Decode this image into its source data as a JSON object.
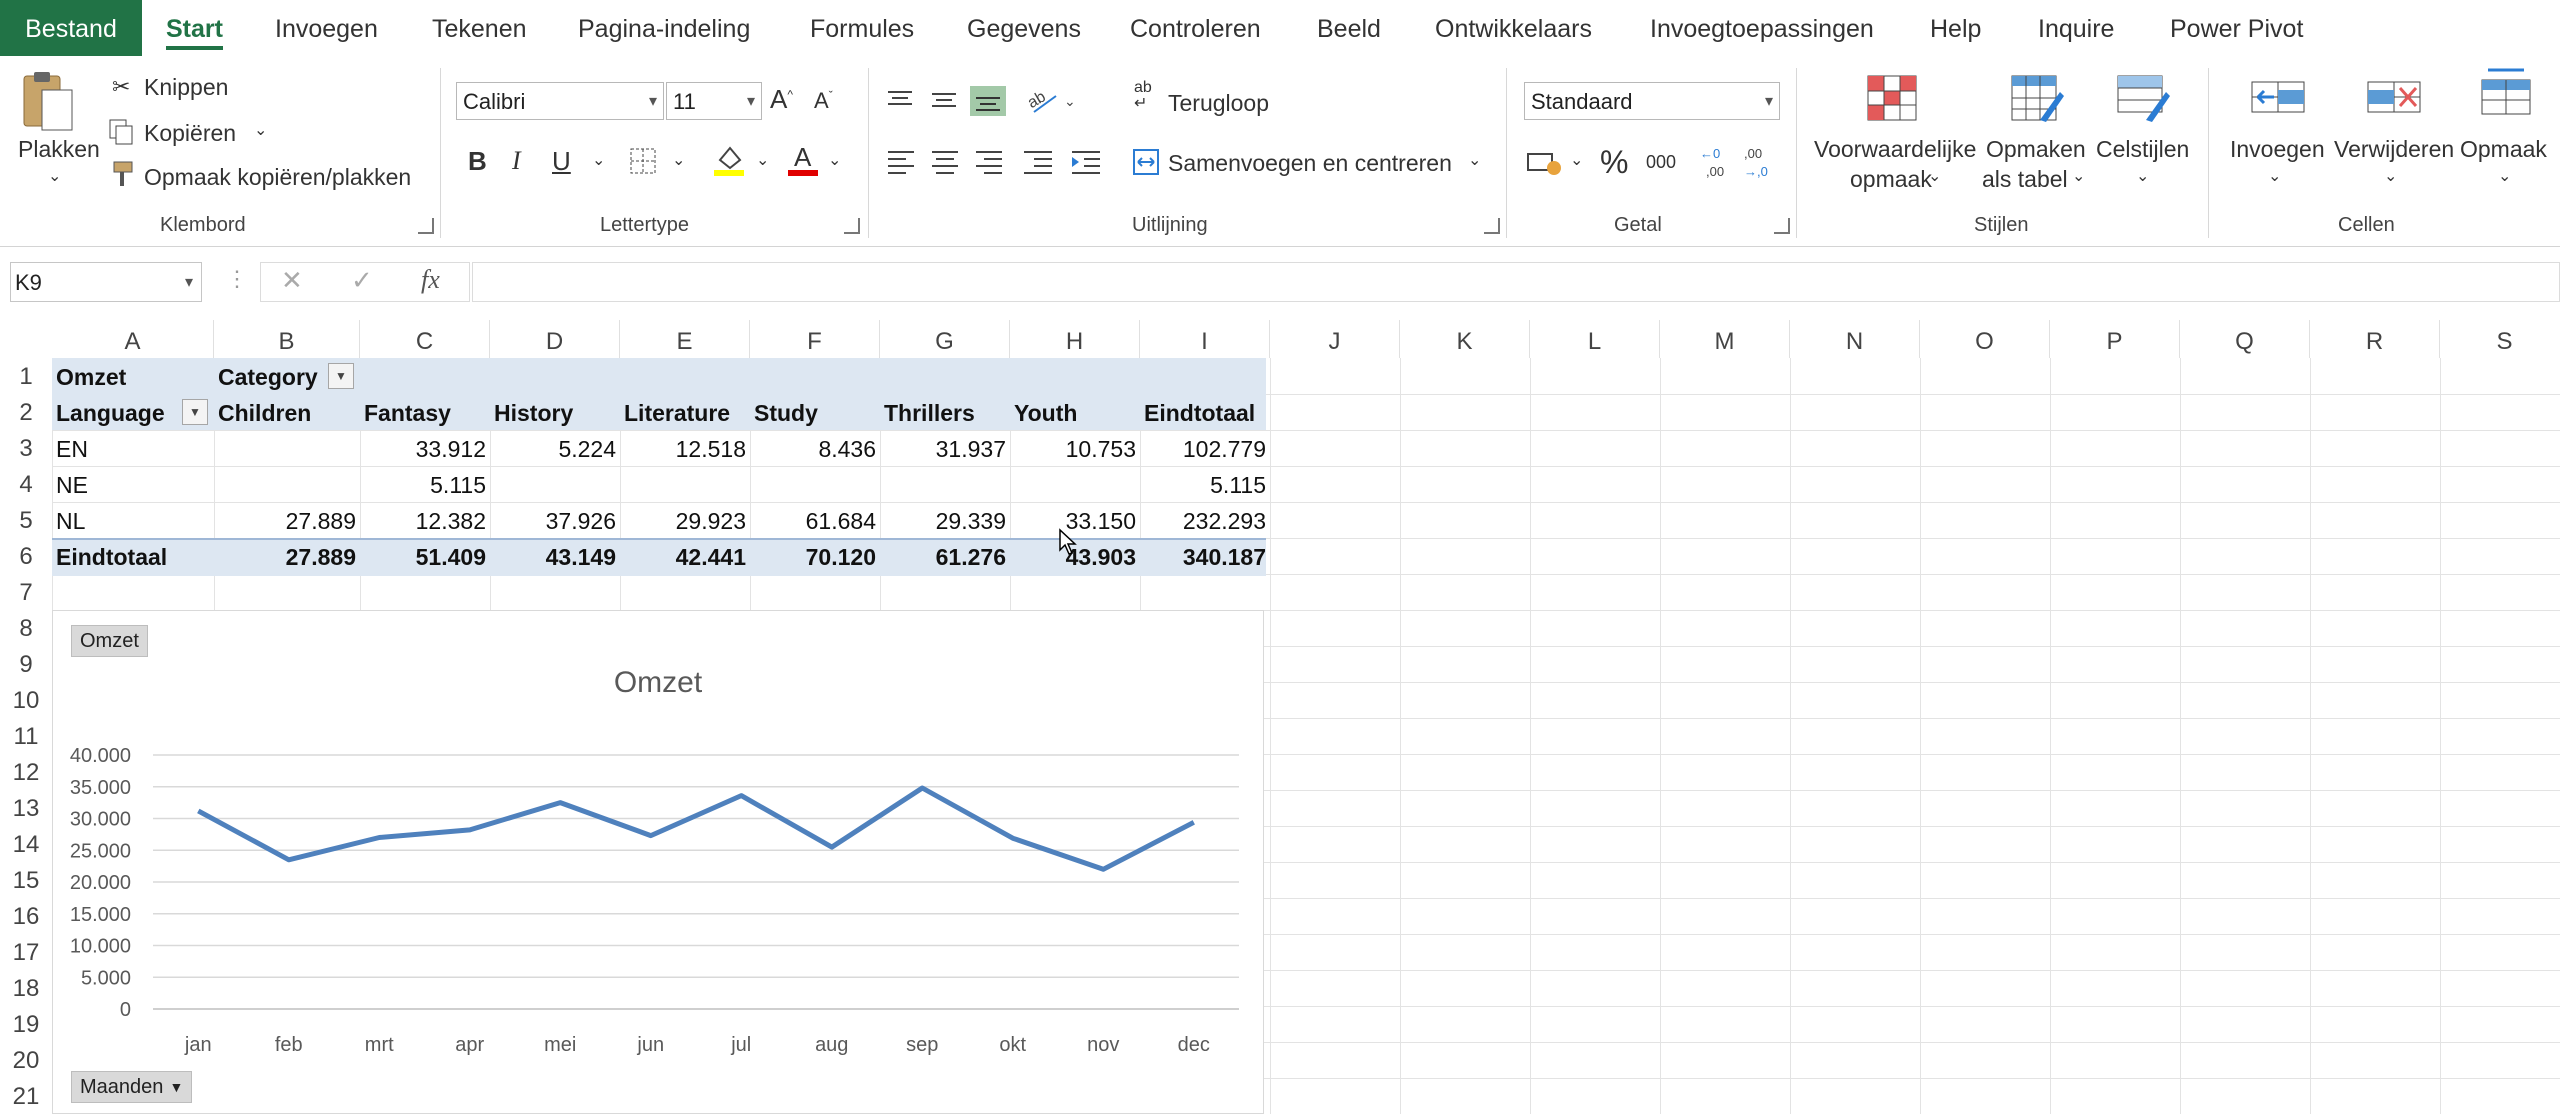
{
  "tabs": [
    "Bestand",
    "Start",
    "Invoegen",
    "Tekenen",
    "Pagina-indeling",
    "Formules",
    "Gegevens",
    "Controleren",
    "Beeld",
    "Ontwikkelaars",
    "Invoegtoepassingen",
    "Help",
    "Inquire",
    "Power Pivot"
  ],
  "clipboard": {
    "paste": "Plakken",
    "cut": "Knippen",
    "copy": "Kopiëren",
    "format_painter": "Opmaak kopiëren/plakken",
    "group": "Klembord"
  },
  "font": {
    "name": "Calibri",
    "size": "11",
    "group": "Lettertype",
    "bold": "B",
    "italic": "I",
    "underline": "U"
  },
  "alignment": {
    "wrap": "Terugloop",
    "merge": "Samenvoegen en centreren",
    "group": "Uitlijning"
  },
  "number": {
    "format": "Standaard",
    "group": "Getal",
    "percent": "%",
    "thousands": "000"
  },
  "styles": {
    "conditional_l1": "Voorwaardelijke",
    "conditional_l2": "opmaak",
    "table_l1": "Opmaken",
    "table_l2": "als tabel",
    "cell_styles": "Celstijlen",
    "group": "Stijlen"
  },
  "cells": {
    "insert": "Invoegen",
    "delete": "Verwijderen",
    "format": "Opmaak",
    "group": "Cellen"
  },
  "formula_bar": {
    "name_box": "K9",
    "fx": "fx",
    "value": ""
  },
  "columns": [
    "A",
    "B",
    "C",
    "D",
    "E",
    "F",
    "G",
    "H",
    "I",
    "J",
    "K",
    "L",
    "M",
    "N",
    "O",
    "P",
    "Q",
    "R",
    "S"
  ],
  "rows": [
    "1",
    "2",
    "3",
    "4",
    "5",
    "6",
    "7",
    "8",
    "9",
    "10",
    "11",
    "12",
    "13",
    "14",
    "15",
    "16",
    "17",
    "18",
    "19",
    "20",
    "21"
  ],
  "pivot": {
    "r1": {
      "a": "Omzet",
      "b": "Category"
    },
    "header": [
      "Language",
      "Children",
      "Fantasy",
      "History",
      "Literature",
      "Study",
      "Thrillers",
      "Youth",
      "Eindtotaal"
    ],
    "data": [
      [
        "EN",
        "",
        "33.912",
        "5.224",
        "12.518",
        "8.436",
        "31.937",
        "10.753",
        "102.779"
      ],
      [
        "NE",
        "",
        "5.115",
        "",
        "",
        "",
        "",
        "",
        "5.115"
      ],
      [
        "NL",
        "27.889",
        "12.382",
        "37.926",
        "29.923",
        "61.684",
        "29.339",
        "33.150",
        "232.293"
      ]
    ],
    "total": [
      "Eindtotaal",
      "27.889",
      "51.409",
      "43.149",
      "42.441",
      "70.120",
      "61.276",
      "43.903",
      "340.187"
    ]
  },
  "chart_data": {
    "type": "line",
    "title": "Omzet",
    "field_value_button": "Omzet",
    "field_axis_button": "Maanden",
    "categories": [
      "jan",
      "feb",
      "mrt",
      "apr",
      "mei",
      "jun",
      "jul",
      "aug",
      "sep",
      "okt",
      "nov",
      "dec"
    ],
    "values": [
      31200,
      23500,
      27000,
      28200,
      32500,
      27300,
      33600,
      25500,
      34800,
      26900,
      22000,
      29400
    ],
    "ylim": [
      0,
      40000
    ],
    "yticks": [
      0,
      5000,
      10000,
      15000,
      20000,
      25000,
      30000,
      35000,
      40000
    ],
    "ytick_labels": [
      "0",
      "5.000",
      "10.000",
      "15.000",
      "20.000",
      "25.000",
      "30.000",
      "35.000",
      "40.000"
    ],
    "line_color": "#4f81bd",
    "grid": true,
    "legend": "none"
  }
}
